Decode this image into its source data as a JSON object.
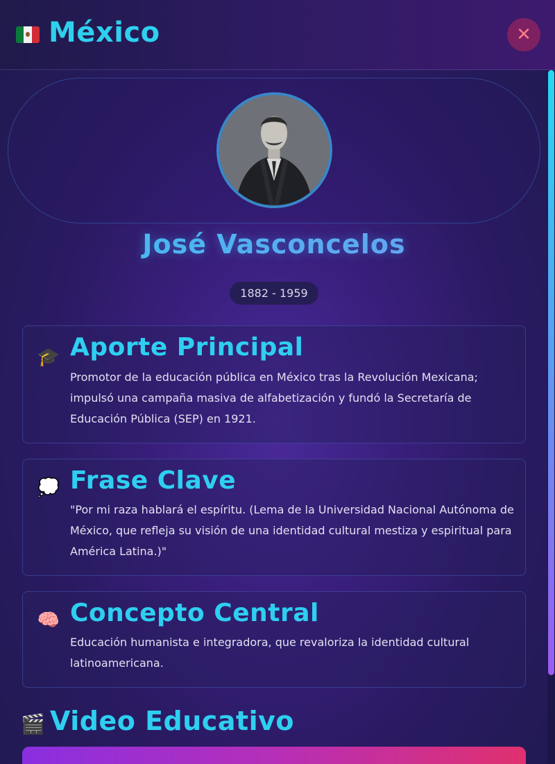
{
  "header": {
    "country": "México",
    "flag_icon": "mexico-flag-icon",
    "close_symbol": "✕"
  },
  "profile": {
    "name": "José Vasconcelos",
    "years": "1882 - 1959"
  },
  "sections": [
    {
      "icon": "🎓",
      "title": "Aporte Principal",
      "text": "Promotor de la educación pública en México tras la Revolución Mexicana; impulsó una campaña masiva de alfabetización y fundó la Secretaría de Educación Pública (SEP) en 1921."
    },
    {
      "icon": "💭",
      "title": "Frase Clave",
      "text": "\"Por mi raza hablará el espíritu. (Lema de la Universidad Nacional Autónoma de México, que refleja su visión de una identidad cultural mestiza y espiritual para América Latina.)\""
    },
    {
      "icon": "🧠",
      "title": "Concepto Central",
      "text": "Educación humanista e integradora, que revaloriza la identidad cultural latinoamericana."
    }
  ],
  "video": {
    "icon": "🎬",
    "title": "Video Educativo"
  },
  "colors": {
    "accent": "#2ecff0",
    "card_border": "#465ab4",
    "close_bg": "#b4285a"
  }
}
